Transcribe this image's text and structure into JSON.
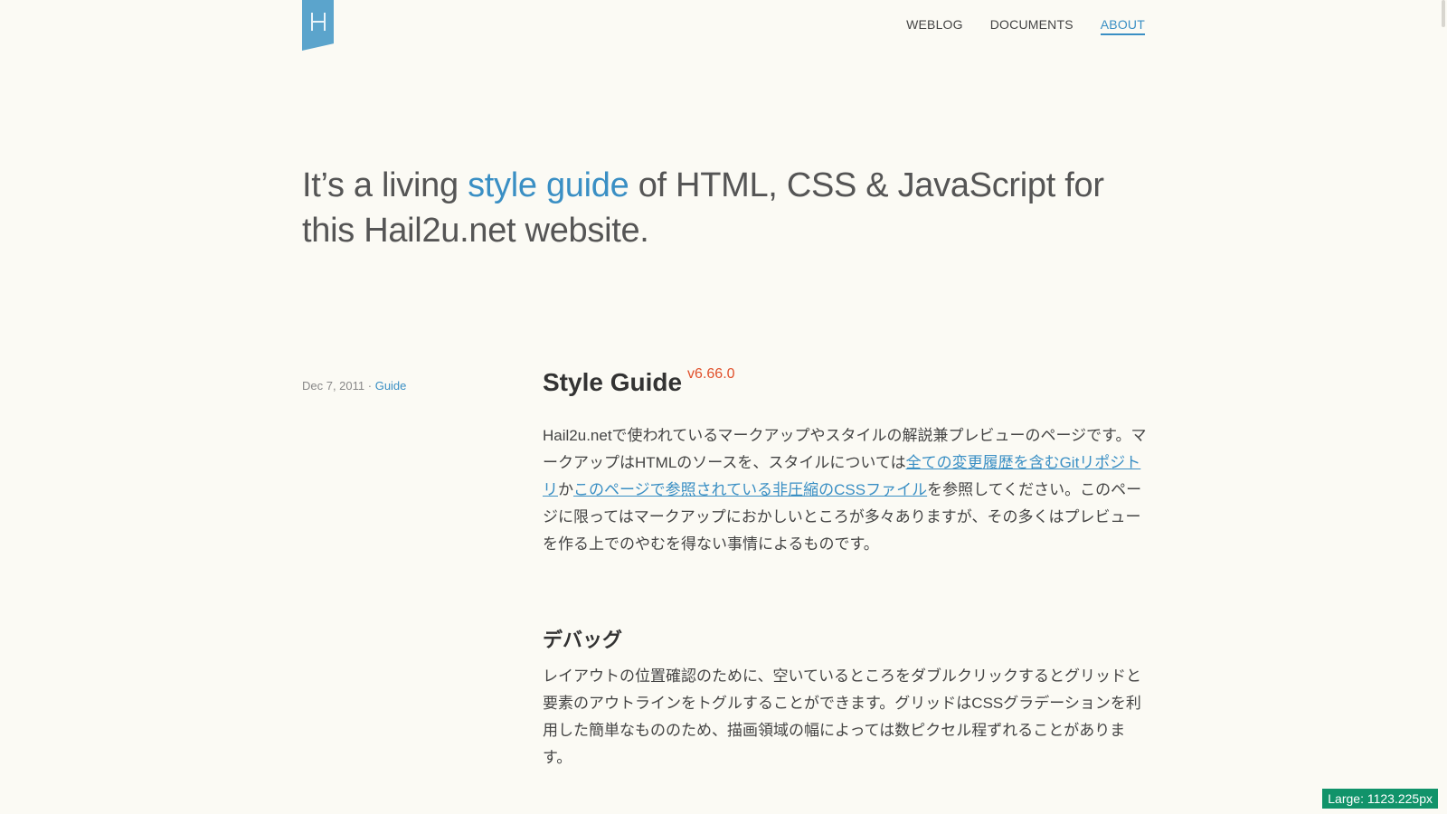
{
  "nav": {
    "items": [
      {
        "label": "WEBLOG",
        "active": false
      },
      {
        "label": "DOCUMENTS",
        "active": false
      },
      {
        "label": "ABOUT",
        "active": true
      }
    ]
  },
  "hero": {
    "part1": "It’s a living ",
    "link": "style guide",
    "part2": " of HTML, CSS & JavaScript for this Hail2u.net website."
  },
  "meta": {
    "date": "Dec 7, 2011",
    "separator": " · ",
    "category": "Guide"
  },
  "article": {
    "title": "Style Guide",
    "version": "v6.66.0",
    "intro": {
      "t1": "Hail2u.netで使われているマークアップやスタイルの解説兼プレビューのページです。マークアップはHTMLのソースを、スタイルについては",
      "link1": "全ての変更履歴を含むGitリポジトリ",
      "t2": "か",
      "link2": "このページで参照されている非圧縮のCSSファイル",
      "t3": "を参照してください。このページに限ってはマークアップにおかしいところが多々ありますが、その多くはプレビューを作る上でのやむを得ない事情によるものです。"
    },
    "debug_title": "デバッグ",
    "debug_text": "レイアウトの位置確認のために、空いているところをダブルクリックするとグリッドと要素のアウトラインをトグルすることができます。グリッドはCSSグラデーションを利用した簡単なもののため、描画領域の幅によっては数ピクセル程ずれることがあります。"
  },
  "badge": {
    "label": "Large: 1123.225px",
    "color": "#11936a"
  },
  "colors": {
    "accent": "#3a8fc4",
    "version": "#e0502b",
    "background": "#fbfaf4",
    "logo": "#5ba4cc"
  }
}
